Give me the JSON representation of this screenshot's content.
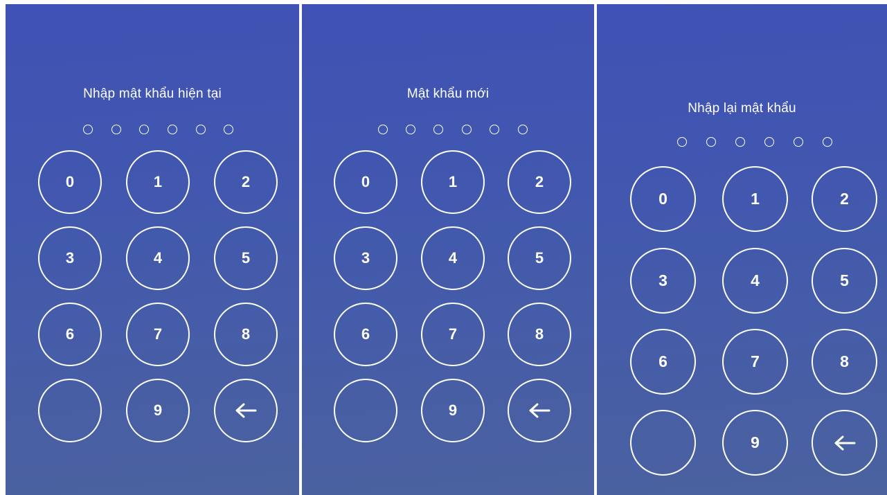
{
  "screens": [
    {
      "title": "Nhập mật khẩu hiện tại",
      "pin_length": 6,
      "pin_filled": 0,
      "keys": [
        "0",
        "1",
        "2",
        "3",
        "4",
        "5",
        "6",
        "7",
        "8",
        "",
        "9",
        "backspace"
      ]
    },
    {
      "title": "Mật khẩu mới",
      "pin_length": 6,
      "pin_filled": 0,
      "keys": [
        "0",
        "1",
        "2",
        "3",
        "4",
        "5",
        "6",
        "7",
        "8",
        "",
        "9",
        "backspace"
      ]
    },
    {
      "title": "Nhập lại mật khẩu",
      "pin_length": 6,
      "pin_filled": 0,
      "keys": [
        "0",
        "1",
        "2",
        "3",
        "4",
        "5",
        "6",
        "7",
        "8",
        "",
        "9",
        "backspace"
      ]
    }
  ],
  "icons": {
    "backspace": "arrow-left-icon"
  },
  "colors": {
    "background_top": "#3f51b5",
    "background_bottom": "#4b629f",
    "foreground": "#ffffff"
  }
}
